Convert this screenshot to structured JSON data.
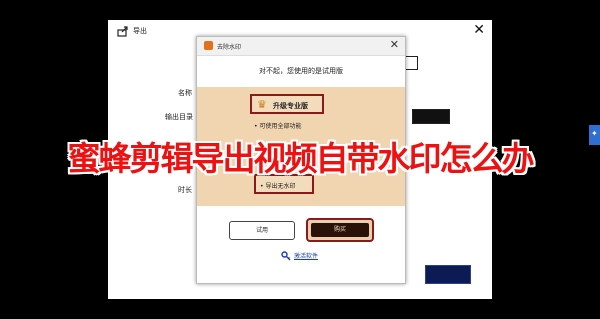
{
  "export_window": {
    "title": "导出",
    "labels": {
      "name": "名称",
      "output_dir": "输出目录",
      "duration": "时长"
    }
  },
  "dialog": {
    "title": "去除水印",
    "message": "对不起，您使用的是试用版",
    "pro_label": "升级专业版",
    "feature": "可使用全部功能",
    "watermark_free": "导出无水印",
    "trial_button": "试用",
    "buy_button": "购买",
    "activate_link": "激活软件"
  },
  "overlay": {
    "caption": "蜜蜂剪辑导出视频自带水印怎么办"
  },
  "colors": {
    "accent_red": "#8b1a1a",
    "panel_bg": "#f1d5b0",
    "caption": "#e11111",
    "link": "#1a3db8"
  }
}
